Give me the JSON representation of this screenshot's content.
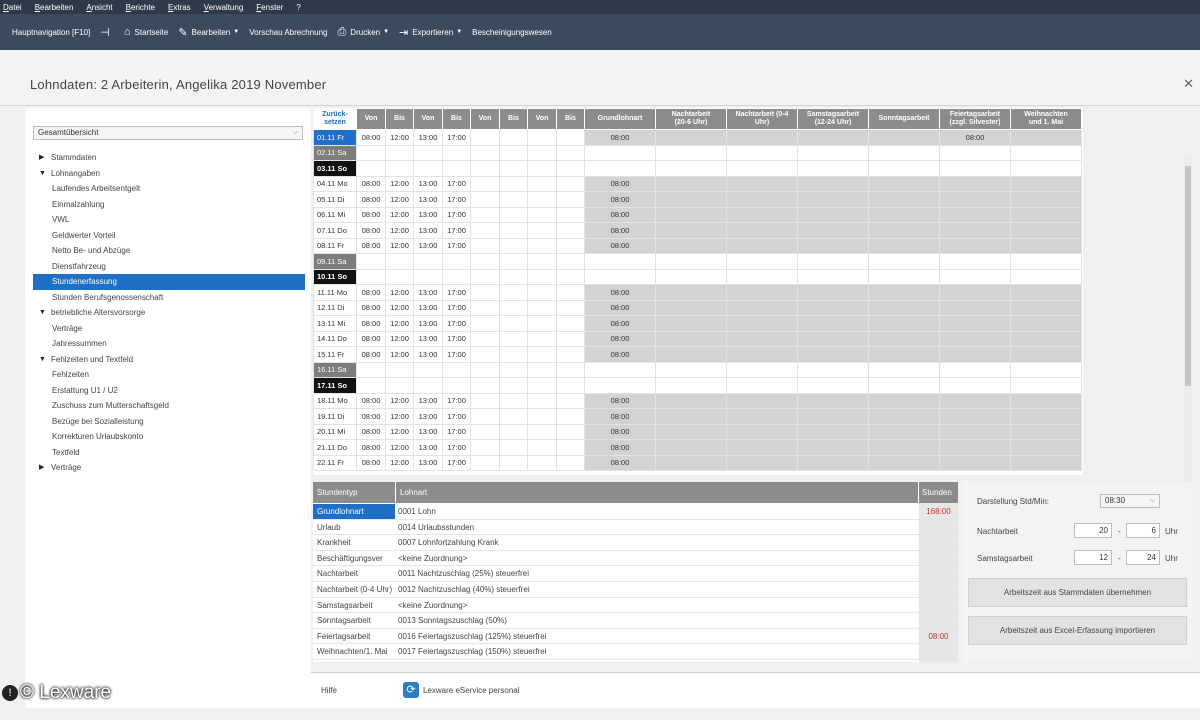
{
  "menu": [
    "Datei",
    "Bearbeiten",
    "Ansicht",
    "Berichte",
    "Extras",
    "Verwaltung",
    "Fenster",
    "?"
  ],
  "toolbar": {
    "nav": "Hauptnavigation [F10]",
    "home": "Startseite",
    "edit": "Bearbeiten",
    "preview": "Vorschau Abrechnung",
    "print": "Drucken",
    "export": "Exportieren",
    "certs": "Bescheinigungswesen"
  },
  "title": "Lohndaten: 2  Arbeiterin, Angelika   2019   November",
  "overview": "Gesamtübersicht",
  "tree": [
    {
      "label": "Stammdaten",
      "arrow": "▶",
      "level": 0
    },
    {
      "label": "Lohnangaben",
      "arrow": "▼",
      "level": 0
    },
    {
      "label": "Laufendes Arbeitsentgelt",
      "level": 1
    },
    {
      "label": "Einmalzahlung",
      "level": 1
    },
    {
      "label": "VWL",
      "level": 1
    },
    {
      "label": "Geldwerter Vorteil",
      "level": 1
    },
    {
      "label": "Netto Be- und Abzüge",
      "level": 1
    },
    {
      "label": "Dienstfahrzeug",
      "level": 1
    },
    {
      "label": "Stundenerfassung",
      "level": 1,
      "selected": true
    },
    {
      "label": "Stunden Berufsgenossenschaft",
      "level": 1
    },
    {
      "label": "betriebliche Altersvorsorge",
      "arrow": "▼",
      "level": 0
    },
    {
      "label": "Verträge",
      "level": 1
    },
    {
      "label": "Jahressummen",
      "level": 1
    },
    {
      "label": "Fehlzeiten und Textfeld",
      "arrow": "▼",
      "level": 0
    },
    {
      "label": "Fehlzeiten",
      "level": 1
    },
    {
      "label": "Erstattung U1 / U2",
      "level": 1
    },
    {
      "label": "Zuschuss zum Mutterschaftsgeld",
      "level": 1
    },
    {
      "label": "Bezüge bei Sozialleistung",
      "level": 1
    },
    {
      "label": "Korrekturen Urlaubskonto",
      "level": 1
    },
    {
      "label": "Textfeld",
      "level": 1
    },
    {
      "label": "Verträge",
      "arrow": "▶",
      "level": 0
    }
  ],
  "grid": {
    "headers": [
      "Zurück-\nsetzen",
      "Von",
      "Bis",
      "Von",
      "Bis",
      "Von",
      "Bis",
      "Von",
      "Bis",
      "Grundlohnart",
      "Nachtarbeit\n(20-6 Uhr)",
      "Nachtarbeit (0-4\nUhr)",
      "Samstagsarbeit\n(12-24 Uhr)",
      "Sonntagsarbeit",
      "Feiertagsarbeit\n(zzgl. Silvester)",
      "Weihnachten\nund 1. Mai"
    ],
    "rows": [
      {
        "date": "01.11 Fr",
        "type": "today",
        "times": [
          "08:00",
          "12:00",
          "13:00",
          "17:00"
        ],
        "grund": "08:00",
        "feiertag": "08:00"
      },
      {
        "date": "02.11 Sa",
        "type": "sat"
      },
      {
        "date": "03.11 So",
        "type": "sun"
      },
      {
        "date": "04.11 Mo",
        "type": "wk",
        "times": [
          "08:00",
          "12:00",
          "13:00",
          "17:00"
        ],
        "grund": "08:00"
      },
      {
        "date": "05.11 Di",
        "type": "wk",
        "times": [
          "08:00",
          "12:00",
          "13:00",
          "17:00"
        ],
        "grund": "08:00"
      },
      {
        "date": "06.11 Mi",
        "type": "wk",
        "times": [
          "08:00",
          "12:00",
          "13:00",
          "17:00"
        ],
        "grund": "08:00"
      },
      {
        "date": "07.11 Do",
        "type": "wk",
        "times": [
          "08:00",
          "12:00",
          "13:00",
          "17:00"
        ],
        "grund": "08:00"
      },
      {
        "date": "08.11 Fr",
        "type": "wk",
        "times": [
          "08:00",
          "12:00",
          "13:00",
          "17:00"
        ],
        "grund": "08:00"
      },
      {
        "date": "09.11 Sa",
        "type": "sat"
      },
      {
        "date": "10.11 So",
        "type": "sun"
      },
      {
        "date": "11.11 Mo",
        "type": "wk",
        "times": [
          "08:00",
          "12:00",
          "13:00",
          "17:00"
        ],
        "grund": "08:00"
      },
      {
        "date": "12.11 Di",
        "type": "wk",
        "times": [
          "08:00",
          "12:00",
          "13:00",
          "17:00"
        ],
        "grund": "08:00"
      },
      {
        "date": "13.11 Mi",
        "type": "wk",
        "times": [
          "08:00",
          "12:00",
          "13:00",
          "17:00"
        ],
        "grund": "08:00"
      },
      {
        "date": "14.11 Do",
        "type": "wk",
        "times": [
          "08:00",
          "12:00",
          "13:00",
          "17:00"
        ],
        "grund": "08:00"
      },
      {
        "date": "15.11 Fr",
        "type": "wk",
        "times": [
          "08:00",
          "12:00",
          "13:00",
          "17:00"
        ],
        "grund": "08:00"
      },
      {
        "date": "16.11 Sa",
        "type": "sat"
      },
      {
        "date": "17.11 So",
        "type": "sun"
      },
      {
        "date": "18.11 Mo",
        "type": "wk",
        "times": [
          "08:00",
          "12:00",
          "13:00",
          "17:00"
        ],
        "grund": "08:00"
      },
      {
        "date": "19.11 Di",
        "type": "wk",
        "times": [
          "08:00",
          "12:00",
          "13:00",
          "17:00"
        ],
        "grund": "08:00"
      },
      {
        "date": "20.11 Mi",
        "type": "wk",
        "times": [
          "08:00",
          "12:00",
          "13:00",
          "17:00"
        ],
        "grund": "08:00"
      },
      {
        "date": "21.11 Do",
        "type": "wk",
        "times": [
          "08:00",
          "12:00",
          "13:00",
          "17:00"
        ],
        "grund": "08:00"
      },
      {
        "date": "22.11 Fr",
        "type": "wk",
        "times": [
          "08:00",
          "12:00",
          "13:00",
          "17:00"
        ],
        "grund": "08:00"
      }
    ]
  },
  "wage": {
    "col_type": "Stundentyp",
    "col_lohnart": "Lohnart",
    "col_hours": "Stunden",
    "rows": [
      {
        "type": "Grundlohnart",
        "lohnart": "0001 Lohn",
        "hours": "168:00",
        "selected": true
      },
      {
        "type": "Urlaub",
        "lohnart": "0014 Urlaubsstunden",
        "hours": ""
      },
      {
        "type": "Krankheit",
        "lohnart": "0007 Lohnfortzahlung Krank",
        "hours": ""
      },
      {
        "type": "Beschäftigungsver",
        "lohnart": "<keine Zuordnung>",
        "hours": ""
      },
      {
        "type": "Nachtarbeit",
        "lohnart": "0011 Nachtzuschlag (25%) steuerfrei",
        "hours": ""
      },
      {
        "type": "Nachtarbeit (0-4 Uhr)",
        "lohnart": "0012 Nachtzuschlag (40%) steuerfrei",
        "hours": ""
      },
      {
        "type": "Samstagsarbeit",
        "lohnart": "<keine Zuordnung>",
        "hours": ""
      },
      {
        "type": "Sonntagsarbeit",
        "lohnart": "0013 Sonntagszuschlag (50%)",
        "hours": ""
      },
      {
        "type": "Feiertagsarbeit",
        "lohnart": "0016 Feiertagszuschlag (125%) steuerfrei",
        "hours": "08:00"
      },
      {
        "type": "Weihnachten/1. Mai",
        "lohnart": "0017 Feiertagszuschlag (150%) steuerfrei",
        "hours": ""
      }
    ]
  },
  "settings": {
    "display_label": "Darstellung Std/Min:",
    "display_value": "08:30",
    "night_label": "Nachtarbeit",
    "night_from": "20",
    "night_to": "6",
    "sat_label": "Samstagsarbeit",
    "sat_from": "12",
    "sat_to": "24",
    "dash": "-",
    "unit": "Uhr",
    "btn_master": "Arbeitszeit aus Stammdaten übernehmen",
    "btn_excel": "Arbeitszeit aus Excel-Erfassung importieren"
  },
  "footer": {
    "help": "Hilfe",
    "eservice": "Lexware eService personal"
  },
  "watermark": "© Lexware",
  "colors": {
    "accent": "#1d6fc8",
    "header": "#8c8c8c",
    "toolbar": "#3c4a5d",
    "hours_red": "#c0392b"
  }
}
